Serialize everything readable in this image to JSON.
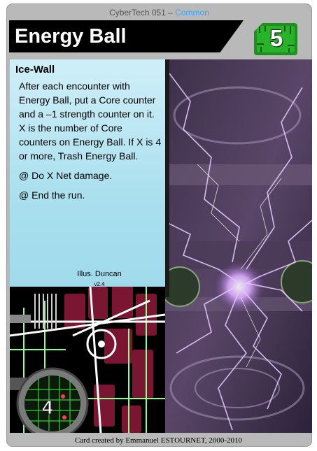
{
  "card": {
    "set_line": "CyberTech 051 – ",
    "rarity": "Common",
    "title": "Energy Ball",
    "cost": "5",
    "subtype": "Ice-Wall",
    "rules": [
      "After each encounter with Energy Ball, put a Core counter and a –1 strength counter on it. X is the number of Core counters on Energy Ball. If X is 4 or more, Trash Energy Ball.",
      "@ Do X Net damage.",
      "@ End the run."
    ],
    "illustrator": "Illus. Duncan",
    "version": "v2.4",
    "strength": "4",
    "footer": "Card created by Emmanuel ESTOURNET, 2000-2010",
    "colors": {
      "frame": "#b9b9b9",
      "title_bar": "#000000",
      "cost_badge": "#1f8f1f",
      "text_box": "#a9dfee",
      "rarity": "#3aa4ff"
    }
  }
}
